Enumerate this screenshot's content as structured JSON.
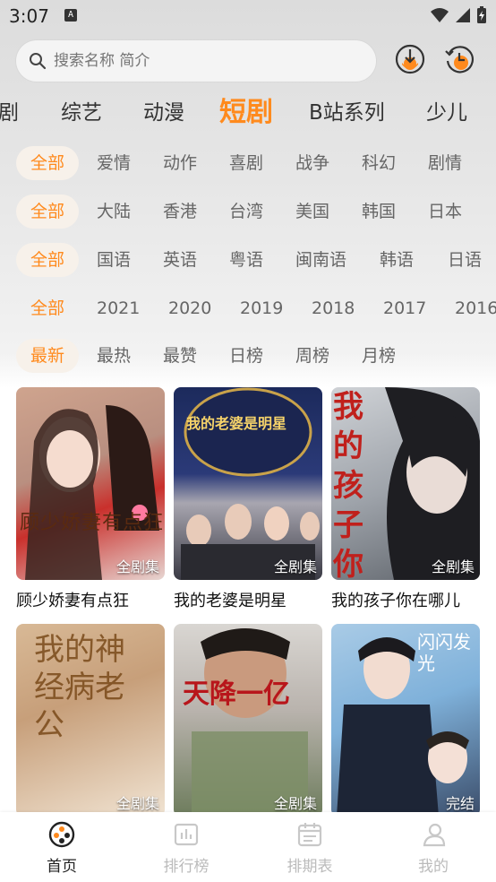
{
  "status": {
    "time": "3:07",
    "notif_letter": "A"
  },
  "search": {
    "placeholder": "搜索名称 简介"
  },
  "categories": [
    {
      "label": "剧"
    },
    {
      "label": "综艺"
    },
    {
      "label": "动漫"
    },
    {
      "label": "短剧"
    },
    {
      "label": "B站系列"
    },
    {
      "label": "少儿"
    }
  ],
  "filters": {
    "genre": [
      "全部",
      "爱情",
      "动作",
      "喜剧",
      "战争",
      "科幻",
      "剧情"
    ],
    "region": [
      "全部",
      "大陆",
      "香港",
      "台湾",
      "美国",
      "韩国",
      "日本"
    ],
    "language": [
      "全部",
      "国语",
      "英语",
      "粤语",
      "闽南语",
      "韩语",
      "日语"
    ],
    "year": [
      "全部",
      "2021",
      "2020",
      "2019",
      "2018",
      "2017",
      "2016"
    ],
    "sort": [
      "最新",
      "最热",
      "最赞",
      "日榜",
      "周榜",
      "月榜"
    ]
  },
  "cards": [
    {
      "title": "顾少娇妻有点狂",
      "badge": "全剧集",
      "poster_text": "顾少娇妻有点狂"
    },
    {
      "title": "我的老婆是明星",
      "badge": "全剧集",
      "poster_text": "我的老婆是明星"
    },
    {
      "title": "我的孩子你在哪儿",
      "badge": "全剧集",
      "poster_text": "我的孩子你在哪儿"
    },
    {
      "title": "",
      "badge": "全剧集",
      "poster_text": "我的神经病老公"
    },
    {
      "title": "",
      "badge": "全剧集",
      "poster_text": "天降一亿"
    },
    {
      "title": "",
      "badge": "完结",
      "poster_text": "闪闪发光"
    }
  ],
  "bottom_nav": [
    {
      "label": "首页",
      "icon": "film-reel-icon"
    },
    {
      "label": "排行榜",
      "icon": "chart-icon"
    },
    {
      "label": "排期表",
      "icon": "calendar-icon"
    },
    {
      "label": "我的",
      "icon": "profile-icon"
    }
  ],
  "colors": {
    "accent": "#ff8a1d",
    "chip_bg": "#f7f1ea"
  }
}
